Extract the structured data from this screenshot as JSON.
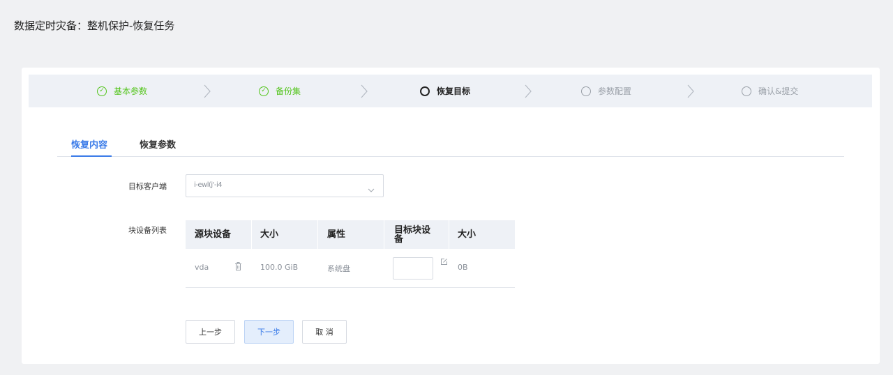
{
  "page": {
    "title": "数据定时灾备：整机保护-恢复任务"
  },
  "steps": [
    {
      "label": "基本参数",
      "state": "done"
    },
    {
      "label": "备份集",
      "state": "done"
    },
    {
      "label": "恢复目标",
      "state": "active"
    },
    {
      "label": "参数配置",
      "state": "pending"
    },
    {
      "label": "确认&提交",
      "state": "pending"
    }
  ],
  "tabs": [
    {
      "label": "恢复内容",
      "active": true
    },
    {
      "label": "恢复参数",
      "active": false
    }
  ],
  "form": {
    "client_label": "目标客户端",
    "client_value": "i-ewl(j'-i4",
    "block_list_label": "块设备列表"
  },
  "table": {
    "headers": [
      "源块设备",
      "大小",
      "属性",
      "目标块设备",
      "大小"
    ],
    "rows": [
      {
        "source": "vda",
        "size": "100.0 GiB",
        "attr": "系统盘",
        "target": "",
        "target_size": "0B"
      }
    ]
  },
  "buttons": {
    "prev": "上一步",
    "next": "下一步",
    "cancel": "取 消"
  },
  "colors": {
    "accent": "#3a7be8",
    "done": "#52c41a",
    "pending": "#9aa0a8"
  }
}
